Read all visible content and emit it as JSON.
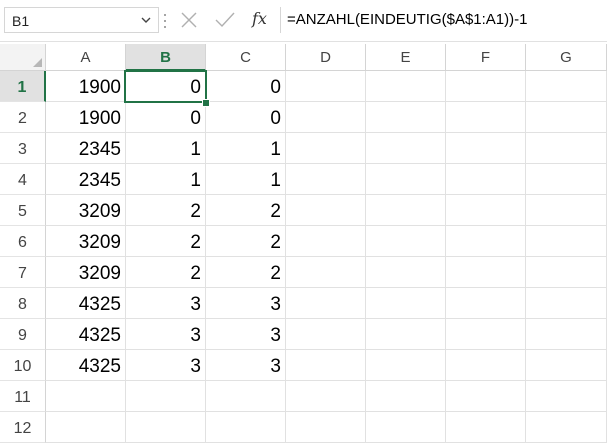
{
  "formula_bar": {
    "name_box": "B1",
    "fx_label": "fx",
    "formula": "=ANZAHL(EINDEUTIG($A$1:A1))-1"
  },
  "columns": [
    "A",
    "B",
    "C",
    "D",
    "E",
    "F",
    "G"
  ],
  "rows": [
    {
      "num": "1",
      "cells": [
        "1900",
        "0",
        "0"
      ]
    },
    {
      "num": "2",
      "cells": [
        "1900",
        "0",
        "0"
      ]
    },
    {
      "num": "3",
      "cells": [
        "2345",
        "1",
        "1"
      ]
    },
    {
      "num": "4",
      "cells": [
        "2345",
        "1",
        "1"
      ]
    },
    {
      "num": "5",
      "cells": [
        "3209",
        "2",
        "2"
      ]
    },
    {
      "num": "6",
      "cells": [
        "3209",
        "2",
        "2"
      ]
    },
    {
      "num": "7",
      "cells": [
        "3209",
        "2",
        "2"
      ]
    },
    {
      "num": "8",
      "cells": [
        "4325",
        "3",
        "3"
      ]
    },
    {
      "num": "9",
      "cells": [
        "4325",
        "3",
        "3"
      ]
    },
    {
      "num": "10",
      "cells": [
        "4325",
        "3",
        "3"
      ]
    },
    {
      "num": "11",
      "cells": [
        "",
        "",
        ""
      ]
    },
    {
      "num": "12",
      "cells": [
        "",
        "",
        ""
      ]
    }
  ],
  "selection": {
    "column": "B",
    "row": "1"
  },
  "colors": {
    "accent": "#217346",
    "header_selected_bg": "#e1e1e1",
    "gridline": "#e1e1e1"
  }
}
